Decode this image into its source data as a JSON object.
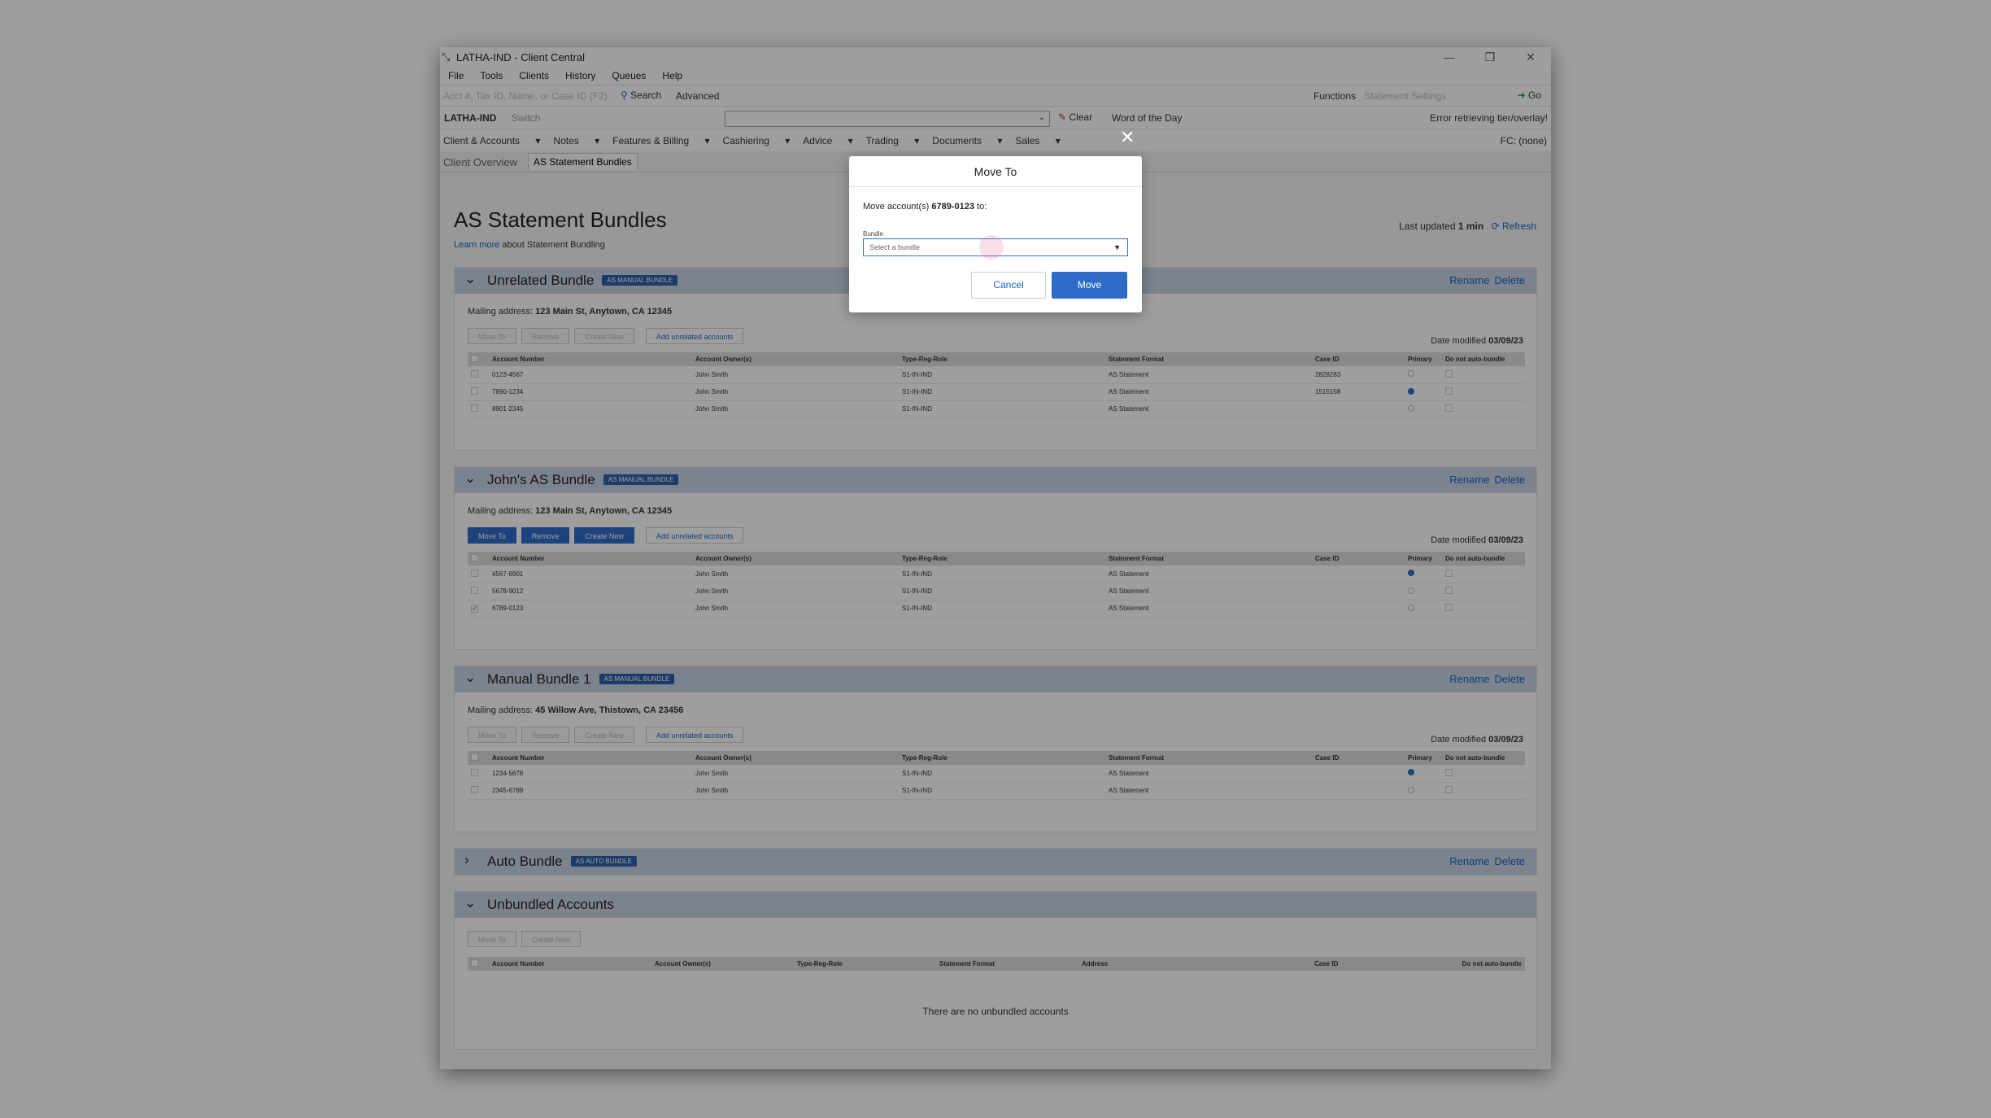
{
  "window": {
    "title": "LATHA-IND - Client Central",
    "controls": [
      "—",
      "❐",
      "✕"
    ]
  },
  "menu": [
    "File",
    "Tools",
    "Clients",
    "History",
    "Queues",
    "Help"
  ],
  "search": {
    "placeholder": "Acct #, Tax ID, Name, or Case ID (F2)",
    "search_label": "Search",
    "advanced_label": "Advanced",
    "functions_label": "Functions",
    "statement_settings_label": "Statement Settings",
    "go_label": "Go"
  },
  "clientbar": {
    "client_name": "LATHA-IND",
    "switch_label": "Switch",
    "clear_label": "Clear",
    "word_of_day_label": "Word of the Day",
    "error_text": "Error retrieving tier/overlay!"
  },
  "nav": {
    "items": [
      "Client & Accounts",
      "Notes",
      "Features & Billing",
      "Cashiering",
      "Advice",
      "Trading",
      "Documents",
      "Sales"
    ],
    "fc_text": "FC: (none)"
  },
  "tabs": [
    "Client Overview",
    "AS Statement Bundles"
  ],
  "page": {
    "title": "AS Statement Bundles",
    "learn_more_link": "Learn more",
    "learn_more_text": "about Statement Bundling",
    "last_updated_label": "Last updated",
    "last_updated_value": "1 min",
    "refresh_label": "Refresh"
  },
  "labels": {
    "rename": "Rename",
    "delete": "Delete",
    "mailing_address": "Mailing address:",
    "date_modified": "Date modified",
    "move_to": "Move To",
    "remove": "Remove",
    "create_new": "Create New",
    "add_unrelated": "Add unrelated accounts"
  },
  "columns": [
    "Account Number",
    "Account Owner(s)",
    "Type-Reg-Role",
    "Statement Format",
    "Case ID",
    "Primary",
    "Do not auto-bundle"
  ],
  "bundles": [
    {
      "name": "Unrelated Bundle",
      "badge": "AS MANUAL BUNDLE",
      "address": "123 Main St, Anytown, CA 12345",
      "date": "03/09/23",
      "rows": [
        {
          "acct": "0123-4567",
          "owner": "John Smith",
          "type": "S1-IN-IND",
          "format": "AS Statement",
          "case": "2828283"
        },
        {
          "acct": "7890-1234",
          "owner": "John Smith",
          "type": "S1-IN-IND",
          "format": "AS Statement",
          "case": "1515158"
        },
        {
          "acct": "8901-2345",
          "owner": "John Smith",
          "type": "S1-IN-IND",
          "format": "AS Statement",
          "case": ""
        }
      ]
    },
    {
      "name": "John's AS Bundle",
      "badge": "AS MANUAL BUNDLE",
      "address": "123 Main St, Anytown, CA 12345",
      "date": "03/09/23",
      "rows": [
        {
          "acct": "4567-8901",
          "owner": "John Smith",
          "type": "S1-IN-IND",
          "format": "AS Statement",
          "case": ""
        },
        {
          "acct": "5678-9012",
          "owner": "John Smith",
          "type": "S1-IN-IND",
          "format": "AS Statement",
          "case": ""
        },
        {
          "acct": "6789-0123",
          "owner": "John Smith",
          "type": "S1-IN-IND",
          "format": "AS Statement",
          "case": ""
        }
      ]
    },
    {
      "name": "Manual Bundle 1",
      "badge": "AS MANUAL BUNDLE",
      "address": "45 Willow Ave, Thistown, CA 23456",
      "date": "03/09/23",
      "rows": [
        {
          "acct": "1234-5678",
          "owner": "John Smith",
          "type": "S1-IN-IND",
          "format": "AS Statement",
          "case": ""
        },
        {
          "acct": "2345-6789",
          "owner": "John Smith",
          "type": "S1-IN-IND",
          "format": "AS Statement",
          "case": ""
        }
      ]
    },
    {
      "name": "Auto Bundle",
      "badge": "AS AUTO BUNDLE"
    }
  ],
  "unbundled": {
    "title": "Unbundled Accounts",
    "columns": [
      "Account Number",
      "Account Owner(s)",
      "Type-Reg-Role",
      "Statement Format",
      "Address",
      "Case ID",
      "Do not auto-bundle"
    ],
    "empty_text": "There are no unbundled accounts"
  },
  "modal": {
    "title": "Move To",
    "message_prefix": "Move account(s)",
    "account": "6789-0123",
    "message_suffix": "to:",
    "bundle_label": "Bundle",
    "select_placeholder": "Select a bundle",
    "cancel_label": "Cancel",
    "move_label": "Move"
  }
}
